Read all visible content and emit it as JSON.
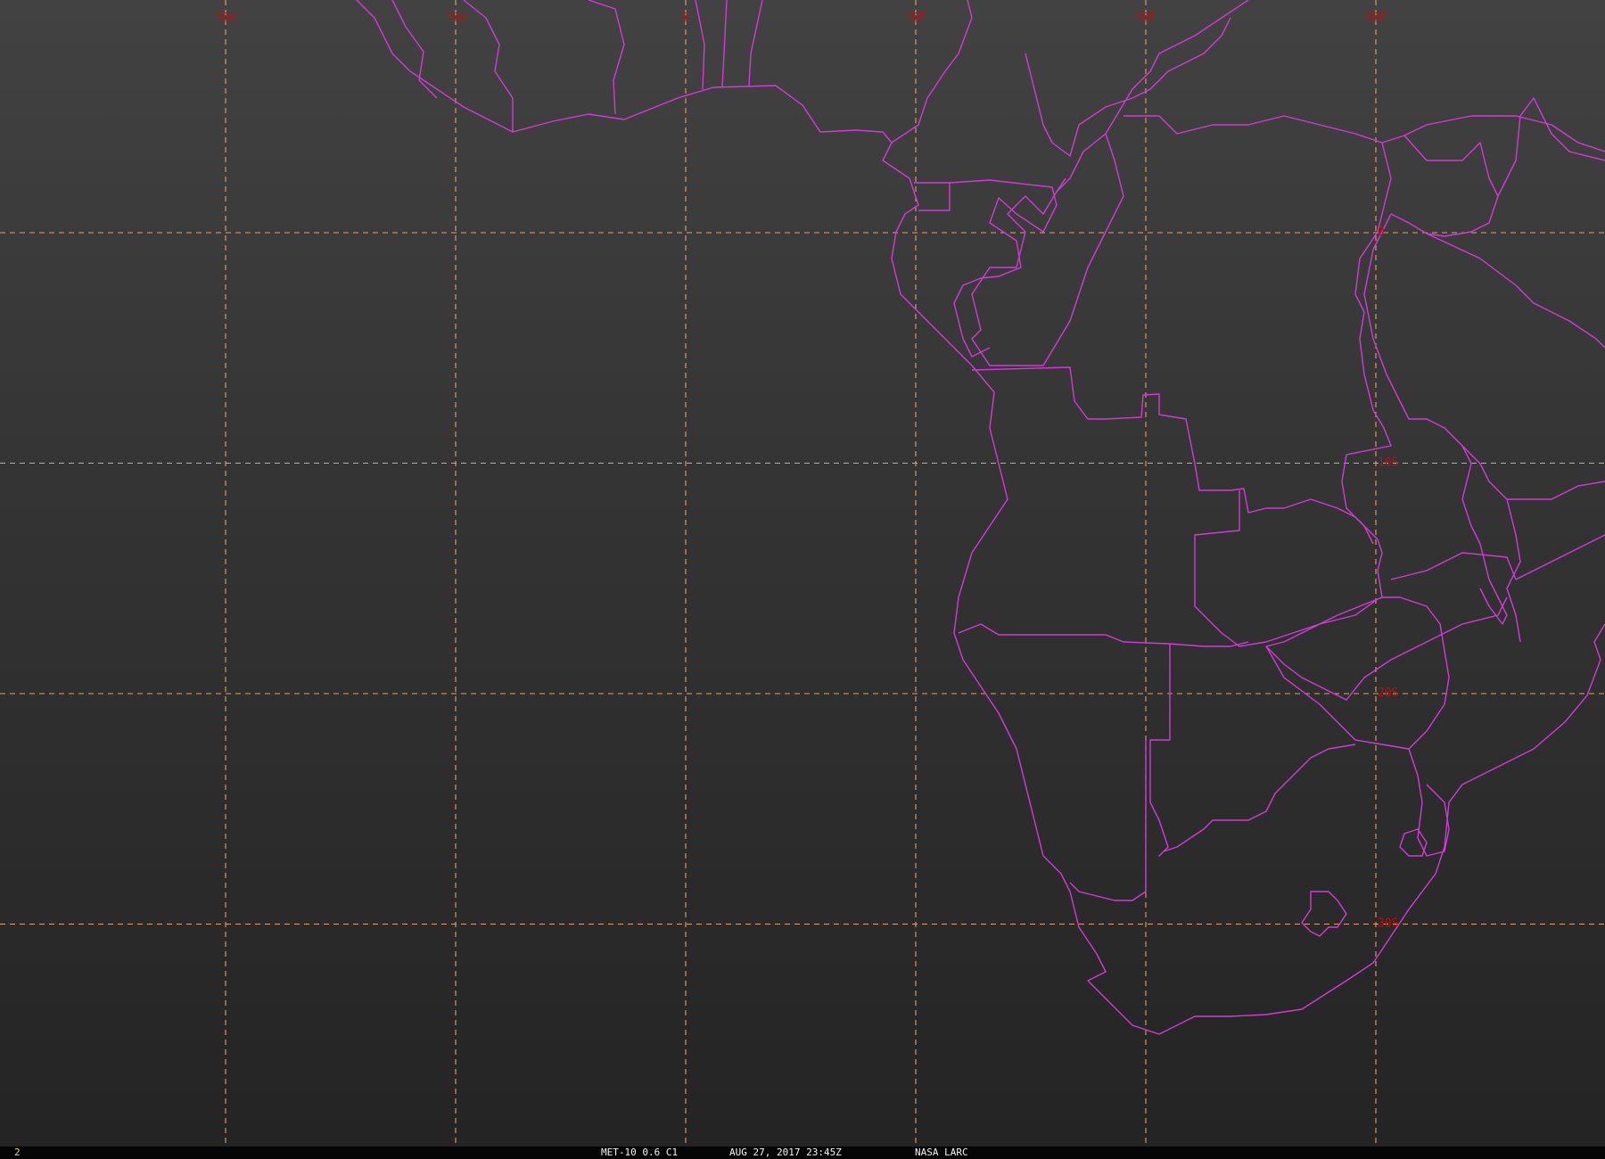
{
  "map": {
    "grid": {
      "longitude_labels": [
        {
          "text": "20W",
          "lon": -20
        },
        {
          "text": "10W",
          "lon": -10
        },
        {
          "text": "0",
          "lon": 0
        },
        {
          "text": "10E",
          "lon": 10
        },
        {
          "text": "20E",
          "lon": 20
        },
        {
          "text": "30E",
          "lon": 30
        }
      ],
      "latitude_labels": [
        {
          "text": "0",
          "lat": 0
        },
        {
          "text": "10S",
          "lat": -10
        },
        {
          "text": "20S",
          "lat": -20
        },
        {
          "text": "30S",
          "lat": -30
        }
      ],
      "line_color": "#e6a06a",
      "label_color": "#b31212"
    },
    "border_color": "#d23ad8",
    "background_color": "#333333"
  },
  "status_bar": {
    "frame_number": "2",
    "product": "MET-10 0.6 C1",
    "timestamp": "AUG 27, 2017 23:45Z",
    "source": "NASA LARC"
  }
}
